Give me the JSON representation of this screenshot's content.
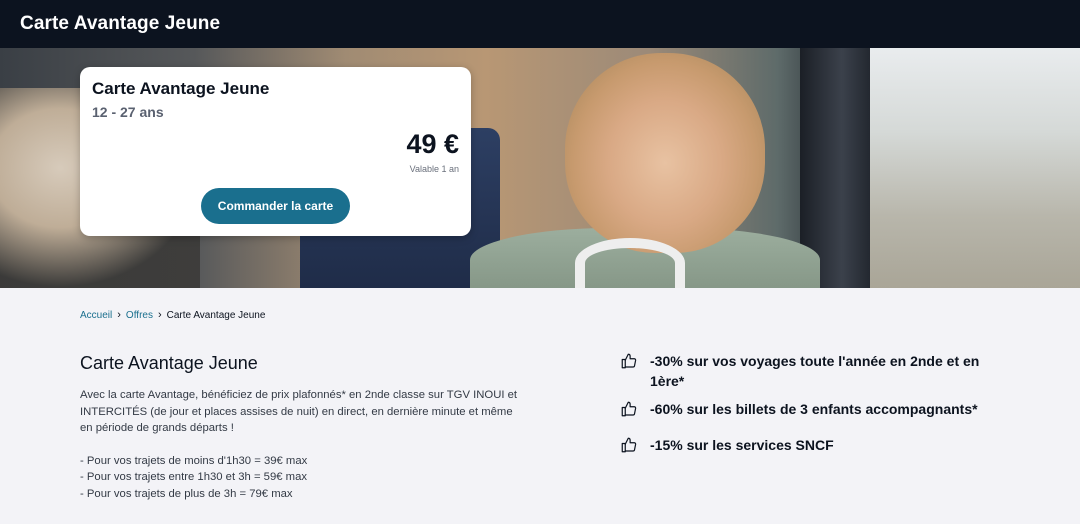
{
  "header": {
    "title": "Carte Avantage Jeune"
  },
  "offer_card": {
    "title": "Carte Avantage Jeune",
    "age_range": "12 - 27 ans",
    "price": "49 €",
    "validity": "Valable 1 an",
    "order_button": "Commander la carte"
  },
  "breadcrumb": {
    "items": [
      "Accueil",
      "Offres",
      "Carte Avantage Jeune"
    ],
    "separator": "›"
  },
  "content": {
    "title": "Carte Avantage Jeune",
    "paragraph": "Avec la carte Avantage, bénéficiez de prix plafonnés* en 2nde classe sur TGV INOUI et INTERCITÉS (de jour et places assises de nuit) en direct, en dernière minute et même en période de grands départs !",
    "price_lines": [
      "- Pour vos trajets de moins d'1h30 = 39€ max",
      "- Pour vos trajets entre 1h30 et 3h = 59€ max",
      "- Pour vos trajets de plus de 3h = 79€ max"
    ]
  },
  "benefits": [
    {
      "icon": "thumbs-up-icon",
      "text": "-30% sur vos voyages toute l'année en 2nde et en 1ère*"
    },
    {
      "icon": "thumbs-up-icon",
      "text": "-60% sur les billets de 3 enfants accompagnants*"
    },
    {
      "icon": "thumbs-up-icon",
      "text": "-15% sur les services SNCF"
    }
  ],
  "colors": {
    "header_bg": "#0c131f",
    "accent": "#1a6f8e",
    "page_bg": "#f3f3f7"
  }
}
